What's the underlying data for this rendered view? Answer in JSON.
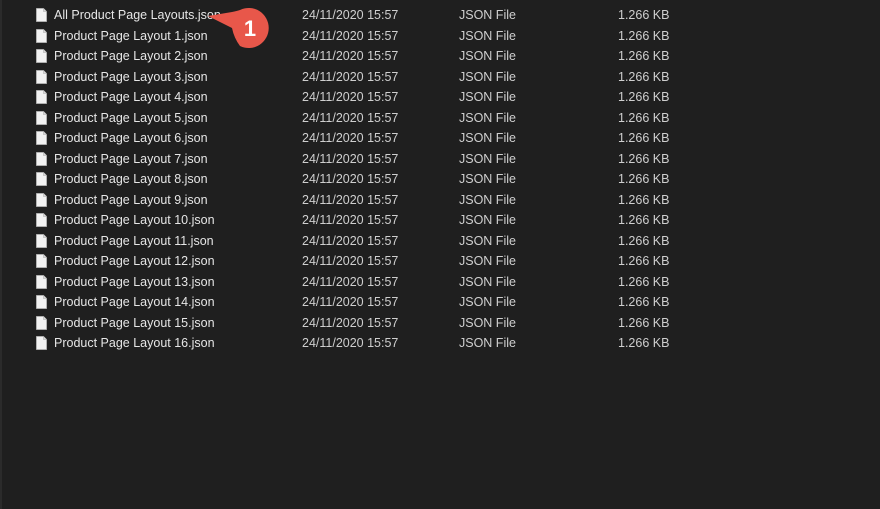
{
  "files": [
    {
      "name": "All Product Page Layouts.json",
      "date": "24/11/2020 15:57",
      "type": "JSON File",
      "size": "1.266 KB"
    },
    {
      "name": "Product Page Layout 1.json",
      "date": "24/11/2020 15:57",
      "type": "JSON File",
      "size": "1.266 KB"
    },
    {
      "name": "Product Page Layout 2.json",
      "date": "24/11/2020 15:57",
      "type": "JSON File",
      "size": "1.266 KB"
    },
    {
      "name": "Product Page Layout 3.json",
      "date": "24/11/2020 15:57",
      "type": "JSON File",
      "size": "1.266 KB"
    },
    {
      "name": "Product Page Layout 4.json",
      "date": "24/11/2020 15:57",
      "type": "JSON File",
      "size": "1.266 KB"
    },
    {
      "name": "Product Page Layout 5.json",
      "date": "24/11/2020 15:57",
      "type": "JSON File",
      "size": "1.266 KB"
    },
    {
      "name": "Product Page Layout 6.json",
      "date": "24/11/2020 15:57",
      "type": "JSON File",
      "size": "1.266 KB"
    },
    {
      "name": "Product Page Layout 7.json",
      "date": "24/11/2020 15:57",
      "type": "JSON File",
      "size": "1.266 KB"
    },
    {
      "name": "Product Page Layout 8.json",
      "date": "24/11/2020 15:57",
      "type": "JSON File",
      "size": "1.266 KB"
    },
    {
      "name": "Product Page Layout 9.json",
      "date": "24/11/2020 15:57",
      "type": "JSON File",
      "size": "1.266 KB"
    },
    {
      "name": "Product Page Layout 10.json",
      "date": "24/11/2020 15:57",
      "type": "JSON File",
      "size": "1.266 KB"
    },
    {
      "name": "Product Page Layout 11.json",
      "date": "24/11/2020 15:57",
      "type": "JSON File",
      "size": "1.266 KB"
    },
    {
      "name": "Product Page Layout 12.json",
      "date": "24/11/2020 15:57",
      "type": "JSON File",
      "size": "1.266 KB"
    },
    {
      "name": "Product Page Layout 13.json",
      "date": "24/11/2020 15:57",
      "type": "JSON File",
      "size": "1.266 KB"
    },
    {
      "name": "Product Page Layout 14.json",
      "date": "24/11/2020 15:57",
      "type": "JSON File",
      "size": "1.266 KB"
    },
    {
      "name": "Product Page Layout 15.json",
      "date": "24/11/2020 15:57",
      "type": "JSON File",
      "size": "1.266 KB"
    },
    {
      "name": "Product Page Layout 16.json",
      "date": "24/11/2020 15:57",
      "type": "JSON File",
      "size": "1.266 KB"
    }
  ],
  "callout": {
    "number": "1",
    "color": "#e8574a"
  },
  "icons": {
    "file": "file-icon"
  },
  "colors": {
    "background": "#1f1f1f",
    "text": "#e6e6e6"
  }
}
